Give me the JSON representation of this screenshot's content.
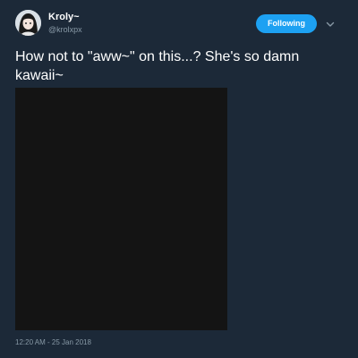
{
  "author": {
    "display_name": "Kroly~",
    "handle": "@krolxpx",
    "avatar_icon": "user-avatar"
  },
  "actions": {
    "follow_label": "Following",
    "menu_icon": "chevron-down-icon"
  },
  "tweet": {
    "text": "How not to \"aww~\" on this...? She's so damn kawaii~",
    "timestamp": "12:20 AM - 25 Jan 2018",
    "media_color": "#141414"
  },
  "colors": {
    "background": "#1c2938",
    "accent": "#1da1f2",
    "secondary_text": "#8899a6"
  }
}
